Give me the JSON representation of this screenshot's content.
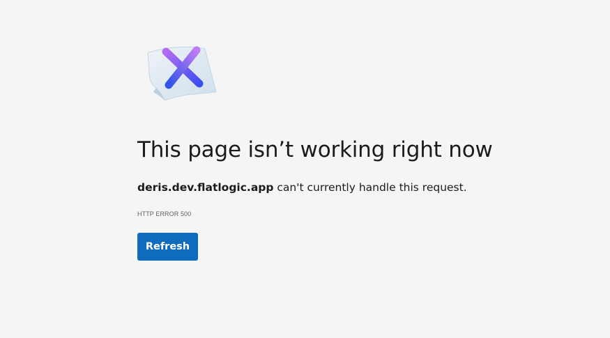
{
  "error": {
    "title": "This page isn’t working right now",
    "host": "deris.dev.flatlogic.app",
    "message_suffix": " can't currently handle this request.",
    "code": "HTTP ERROR 500",
    "refresh_label": "Refresh",
    "icon": "error-x-paper-icon"
  },
  "colors": {
    "background": "#f5f5f5",
    "button": "#0f6cbd",
    "button_text": "#ffffff",
    "text": "#1b1b1b",
    "secondary_text": "#5f5f5f"
  }
}
